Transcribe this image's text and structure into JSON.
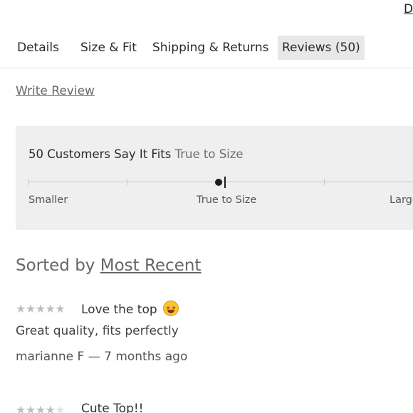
{
  "header": {
    "top_link": "D"
  },
  "tabs": [
    {
      "label": "Details",
      "active": false
    },
    {
      "label": "Size & Fit",
      "active": false
    },
    {
      "label": "Shipping & Returns",
      "active": false
    },
    {
      "label": "Reviews (50)",
      "active": true
    }
  ],
  "write_review_label": "Write Review",
  "fit": {
    "heading": "50 Customers Say It Fits",
    "value": "True to Size",
    "scale_labels": [
      "Smaller",
      "True to Size",
      "Large"
    ],
    "position_fraction": 0.5
  },
  "sort": {
    "prefix": "Sorted by",
    "value": "Most Recent"
  },
  "reviews": [
    {
      "rating": 5,
      "title": "Love the top",
      "emoji": "star-struck-emoji",
      "body": "Great quality, fits perfectly",
      "author": "marianne F",
      "time_ago": "7 months ago",
      "meta": "marianne F — 7 months ago"
    },
    {
      "rating": 4,
      "title": "Cute Top!!"
    }
  ],
  "colors": {
    "active_tab_bg": "#e8e8e8",
    "panel_bg": "#efefef",
    "star_filled": "#bdbdbd",
    "star_empty": "#e2e2e2",
    "fit_marker": "#1d1d1d"
  }
}
